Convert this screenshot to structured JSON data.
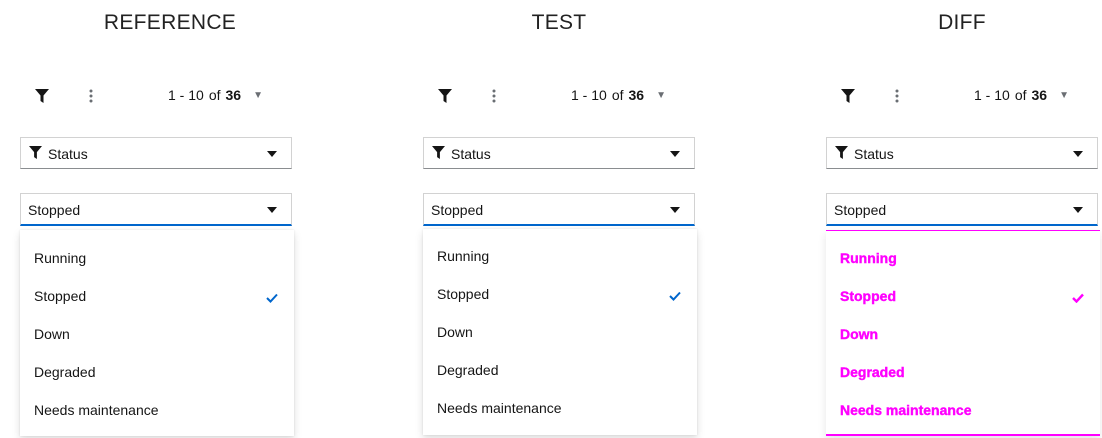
{
  "panels": [
    {
      "id": "reference",
      "title": "REFERENCE",
      "pagination": {
        "range": "1 - 10",
        "of": "of",
        "total": "36"
      },
      "status_select": {
        "label": "Status"
      },
      "value_select": {
        "value": "Stopped"
      },
      "menu": {
        "items": [
          "Running",
          "Stopped",
          "Down",
          "Degraded",
          "Needs maintenance"
        ],
        "checked_index": 1
      }
    },
    {
      "id": "test",
      "title": "TEST",
      "pagination": {
        "range": "1 - 10",
        "of": "of",
        "total": "36"
      },
      "status_select": {
        "label": "Status"
      },
      "value_select": {
        "value": "Stopped"
      },
      "menu": {
        "items": [
          "Running",
          "Stopped",
          "Down",
          "Degraded",
          "Needs maintenance"
        ],
        "checked_index": 1
      }
    },
    {
      "id": "diff",
      "title": "DIFF",
      "pagination": {
        "range": "1 - 10",
        "of": "of",
        "total": "36"
      },
      "status_select": {
        "label": "Status"
      },
      "value_select": {
        "value": "Stopped"
      },
      "menu": {
        "items": [
          "Running",
          "Stopped",
          "Down",
          "Degraded",
          "Needs maintenance"
        ],
        "checked_index": 1
      }
    }
  ],
  "icons": {
    "filter": "filter-icon",
    "kebab": "kebab-icon",
    "caret": "caret-down-icon",
    "check": "check-icon"
  },
  "colors": {
    "accent": "#0066cc",
    "diff_highlight": "#ff00ff",
    "text": "#151515",
    "border": "#d2d2d2"
  }
}
